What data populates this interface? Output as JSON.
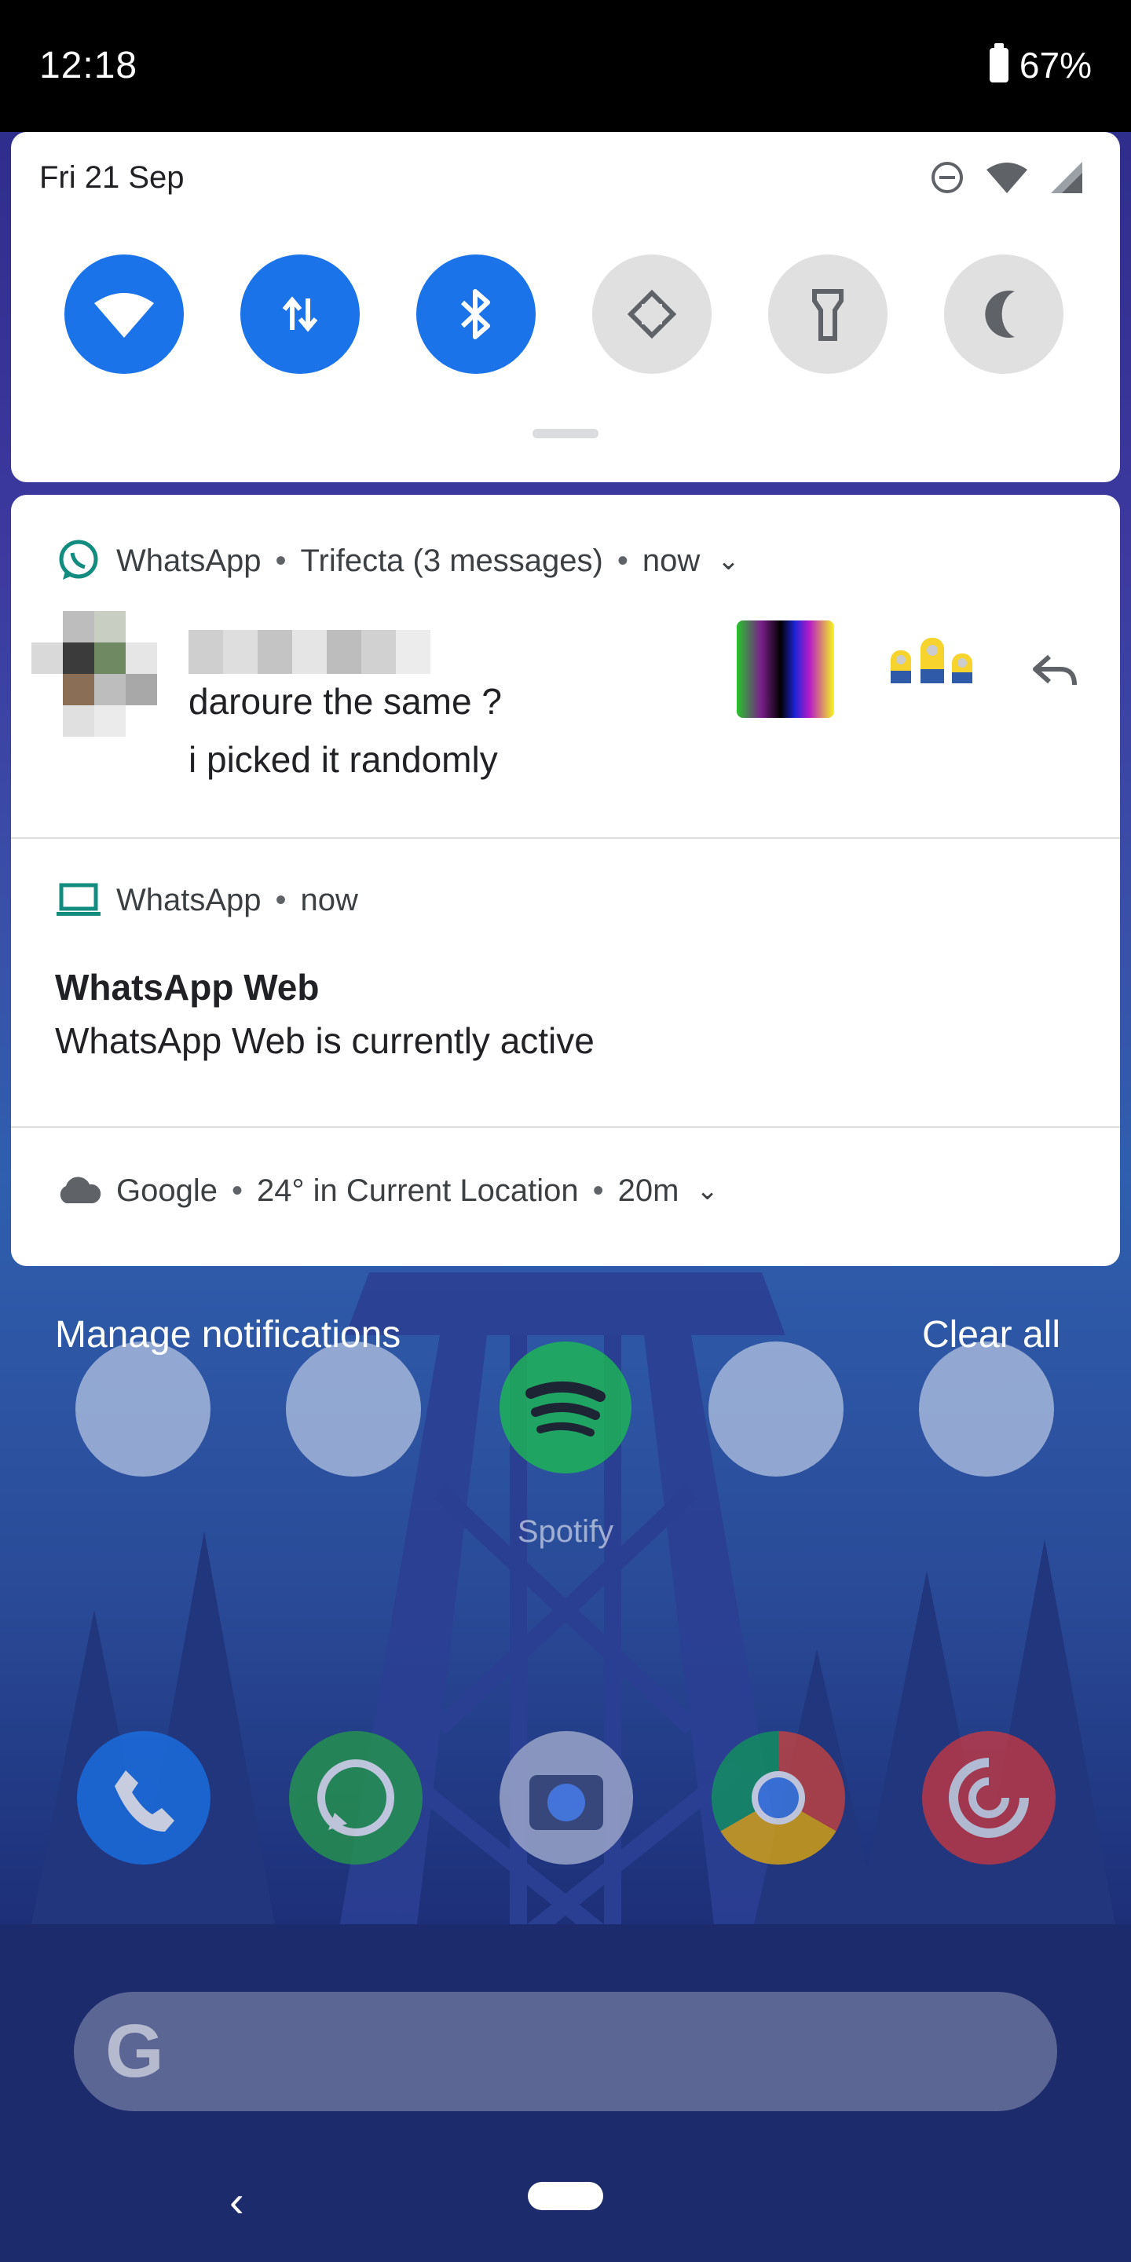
{
  "status_bar": {
    "time": "12:18",
    "battery": "67%"
  },
  "quick_settings": {
    "date": "Fri 21 Sep",
    "tiles": [
      {
        "name": "wifi",
        "state": "on"
      },
      {
        "name": "mobile-data",
        "state": "on"
      },
      {
        "name": "bluetooth",
        "state": "on"
      },
      {
        "name": "auto-rotate",
        "state": "off"
      },
      {
        "name": "flashlight",
        "state": "off"
      },
      {
        "name": "night-light",
        "state": "off"
      }
    ]
  },
  "notifications": {
    "whatsapp_chat": {
      "app": "WhatsApp",
      "group": "Trifecta (3 messages)",
      "time": "now",
      "messages": [
        "daroure the same ?",
        "i picked it randomly"
      ]
    },
    "whatsapp_web": {
      "app": "WhatsApp",
      "time": "now",
      "title": "WhatsApp Web",
      "text": "WhatsApp Web is currently active"
    },
    "google_weather": {
      "app": "Google",
      "detail": "24° in Current Location",
      "time": "20m"
    },
    "manage_label": "Manage notifications",
    "clear_label": "Clear all"
  },
  "home_screen": {
    "spotify_label": "Spotify"
  },
  "colors": {
    "accent_blue": "#1a73e8",
    "whatsapp_green": "#128c7e"
  }
}
